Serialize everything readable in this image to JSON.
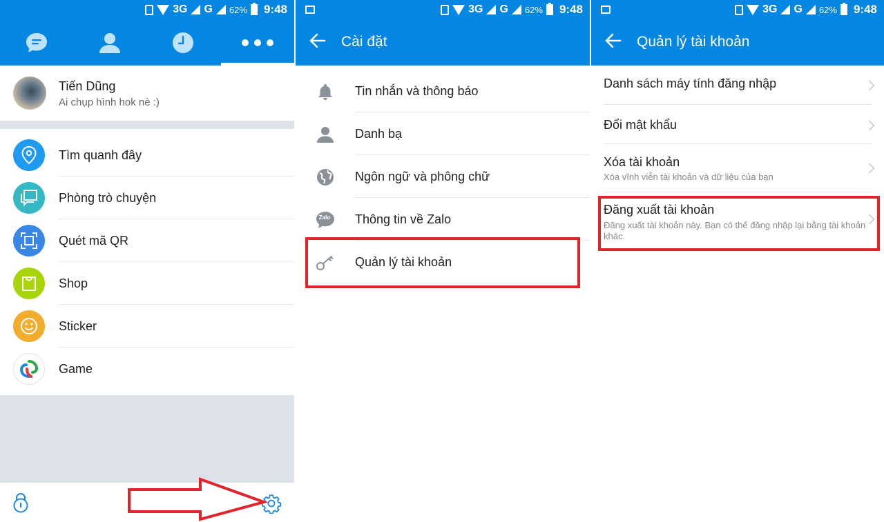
{
  "status_bar": {
    "network": "3G",
    "network2": "G",
    "battery": "62%",
    "time": "9:48"
  },
  "panel1": {
    "tabs": [
      {
        "icon": "chat-bubble-icon"
      },
      {
        "icon": "contacts-icon"
      },
      {
        "icon": "clock-icon"
      },
      {
        "icon": "more-dots-icon",
        "active": true
      }
    ],
    "profile": {
      "name": "Tiến Dũng",
      "status": "Ai chụp hình hok nè :)"
    },
    "menu": [
      {
        "label": "Tìm quanh đây",
        "icon": "location-pin-icon",
        "color": "#1e9af0"
      },
      {
        "label": "Phòng trò chuyện",
        "icon": "chat-rooms-icon",
        "color": "#36b7c4"
      },
      {
        "label": "Quét mã QR",
        "icon": "qr-scan-icon",
        "color": "#3a86e6"
      },
      {
        "label": "Shop",
        "icon": "shopping-bag-icon",
        "color": "#a8d40a"
      },
      {
        "label": "Sticker",
        "icon": "smiley-icon",
        "color": "#f2ad2e"
      },
      {
        "label": "Game",
        "icon": "game-logo-icon",
        "color": "#ffffff"
      }
    ]
  },
  "panel2": {
    "title": "Cài đặt",
    "menu": [
      {
        "label": "Tin nhắn và thông báo",
        "icon": "bell-icon"
      },
      {
        "label": "Danh bạ",
        "icon": "person-icon"
      },
      {
        "label": "Ngôn ngữ và phông chữ",
        "icon": "globe-icon"
      },
      {
        "label": "Thông tin về Zalo",
        "icon": "zalo-logo-icon",
        "icon_text": "Zalo"
      },
      {
        "label": "Quản lý tài khoản",
        "icon": "key-icon"
      }
    ]
  },
  "panel3": {
    "title": "Quản lý tài khoản",
    "menu": [
      {
        "label": "Danh sách máy tính đăng nhập",
        "sub": ""
      },
      {
        "label": "Đổi mật khẩu",
        "sub": ""
      },
      {
        "label": "Xóa tài khoản",
        "sub": "Xóa vĩnh viễn tài khoản và dữ liệu của bạn"
      },
      {
        "label": "Đăng xuất tài khoản",
        "sub": "Đăng xuất tài khoản này. Bạn có thể đăng nhập lại bằng tài khoản khác."
      }
    ]
  },
  "colors": {
    "primary": "#0486e3",
    "highlight": "#e0242b"
  }
}
